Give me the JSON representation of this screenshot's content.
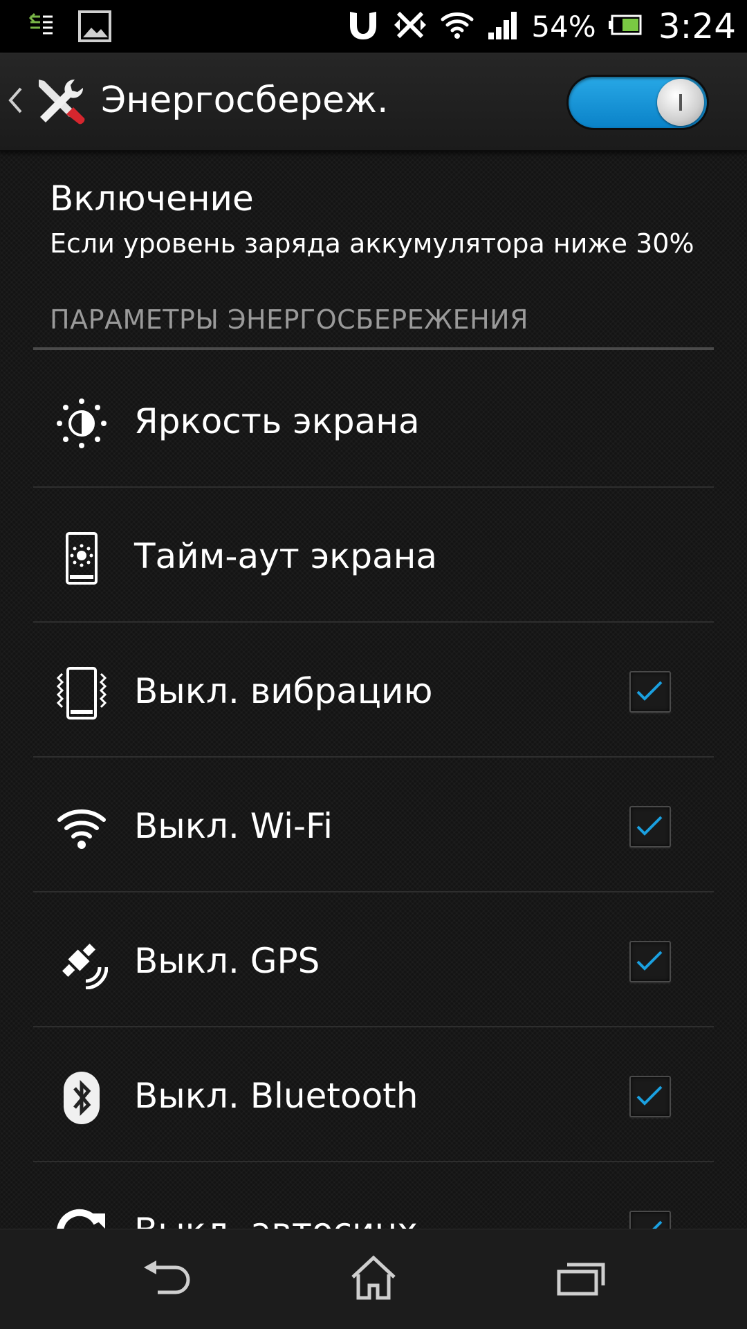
{
  "status_bar": {
    "battery_percent": "54%",
    "time": "3:24",
    "icons": [
      "usb-debug-icon",
      "picture-icon",
      "hotspot-icon",
      "nfc-off-icon",
      "wifi-icon",
      "signal-icon",
      "battery-icon"
    ]
  },
  "action_bar": {
    "title": "Энергосбереж.",
    "toggle_on": true
  },
  "activation": {
    "title": "Включение",
    "subtitle": "Если уровень заряда аккумулятора ниже 30%"
  },
  "section": {
    "header": "ПАРАМЕТРЫ ЭНЕРГОСБЕРЕЖЕНИЯ"
  },
  "items": [
    {
      "label": "Яркость экрана",
      "icon": "brightness-icon",
      "checkbox": false
    },
    {
      "label": "Тайм-аут экрана",
      "icon": "screen-timeout-icon",
      "checkbox": false
    },
    {
      "label": "Выкл. вибрацию",
      "icon": "vibration-icon",
      "checkbox": true,
      "checked": true
    },
    {
      "label": "Выкл. Wi-Fi",
      "icon": "wifi-icon",
      "checkbox": true,
      "checked": true
    },
    {
      "label": "Выкл. GPS",
      "icon": "gps-satellite-icon",
      "checkbox": true,
      "checked": true
    },
    {
      "label": "Выкл. Bluetooth",
      "icon": "bluetooth-icon",
      "checkbox": true,
      "checked": true
    },
    {
      "label": "Выкл. автосинх",
      "icon": "sync-icon",
      "checkbox": true,
      "checked": true
    }
  ],
  "colors": {
    "accent": "#1aa0e0",
    "background": "#141414",
    "text": "#ffffff",
    "section_header": "#9a9a9a"
  },
  "nav_bar": {
    "buttons": [
      "back-icon",
      "home-icon",
      "recent-apps-icon"
    ]
  }
}
